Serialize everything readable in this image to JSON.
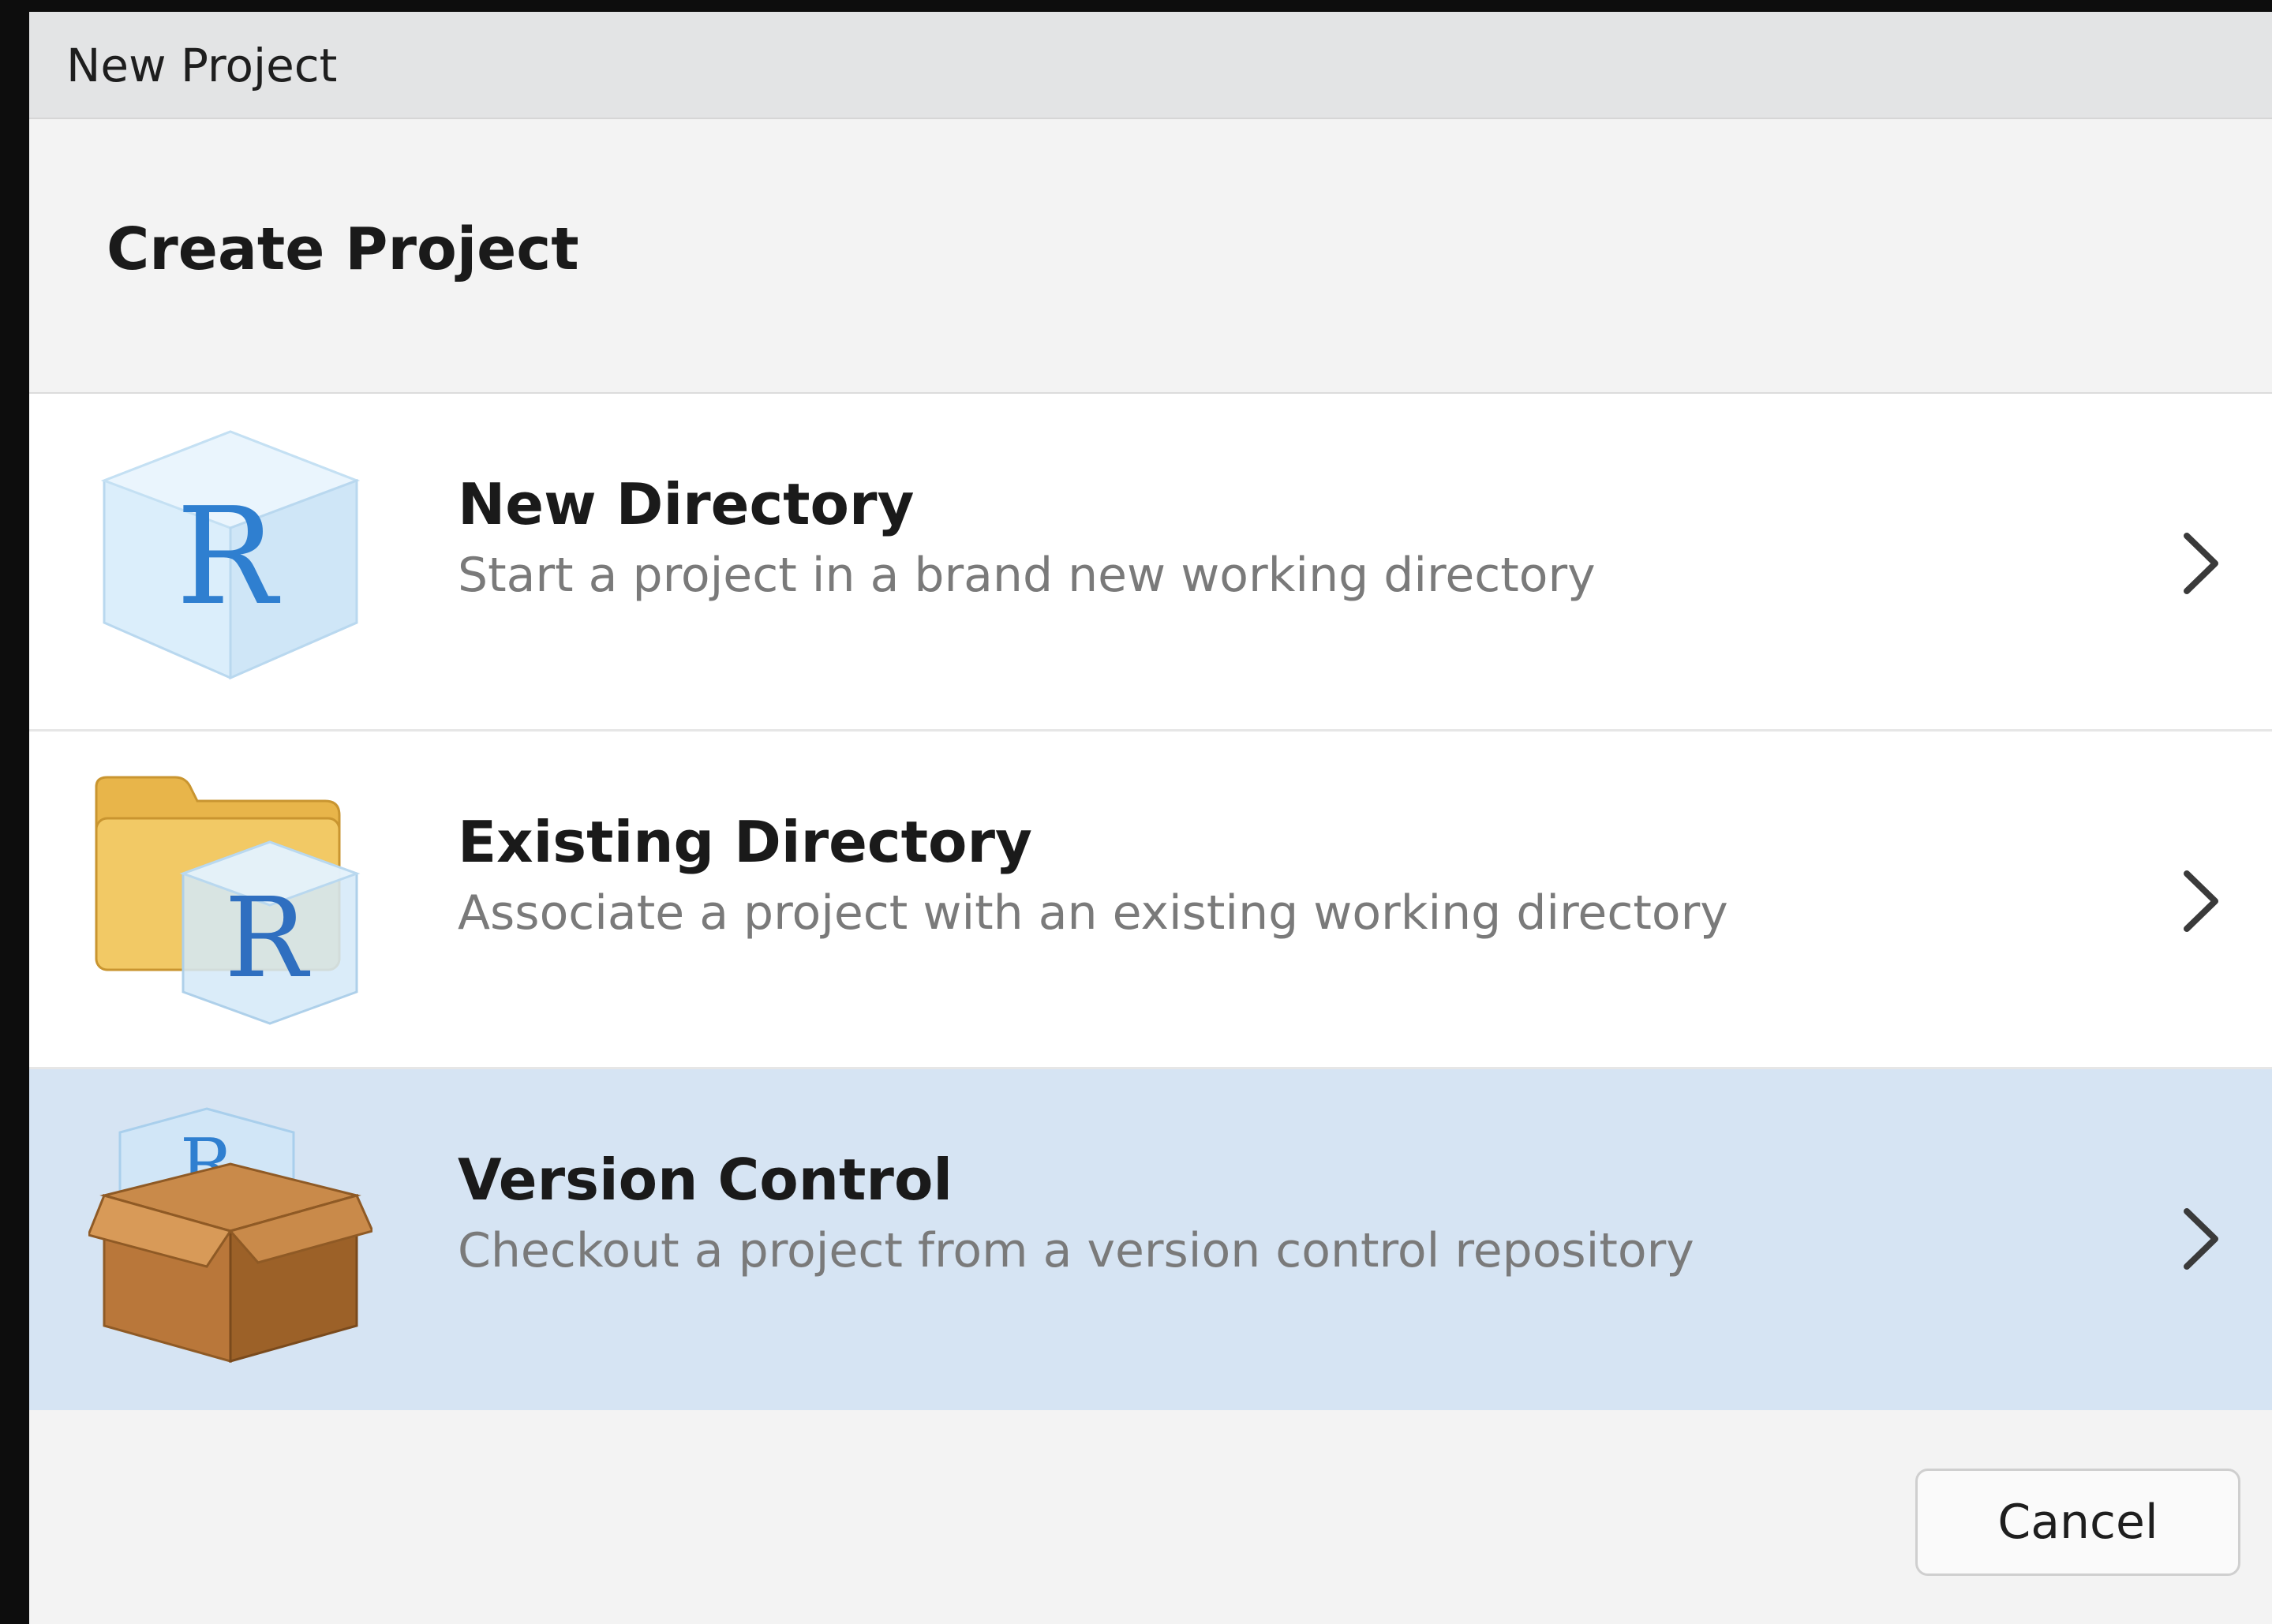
{
  "window": {
    "title": "New Project"
  },
  "header": {
    "title": "Create Project"
  },
  "options": [
    {
      "title": "New Directory",
      "description": "Start a project in a brand new working directory",
      "icon": "r-cube-icon",
      "selected": false
    },
    {
      "title": "Existing Directory",
      "description": "Associate a project with an existing working directory",
      "icon": "folder-r-cube-icon",
      "selected": false
    },
    {
      "title": "Version Control",
      "description": "Checkout a project from a version control repository",
      "icon": "package-box-icon",
      "selected": true
    }
  ],
  "footer": {
    "cancel_label": "Cancel"
  },
  "colors": {
    "selected_row": "#d6e4f3",
    "r_blue": "#2f7fd0",
    "folder_yellow": "#e8b54a",
    "box_brown": "#b9773a"
  }
}
